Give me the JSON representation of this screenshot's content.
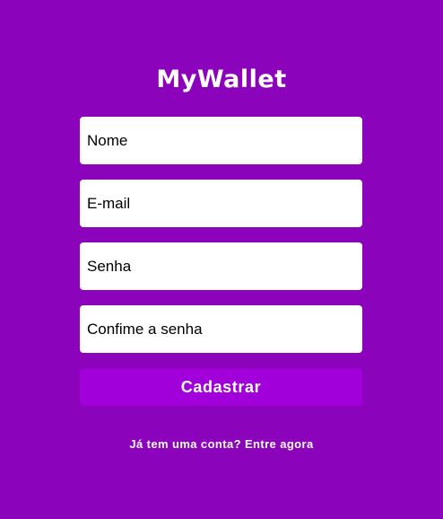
{
  "app": {
    "logo_text": "MyWallet"
  },
  "signup_form": {
    "name_placeholder": "Nome",
    "email_placeholder": "E-mail",
    "password_placeholder": "Senha",
    "confirm_password_placeholder": "Confime a senha",
    "submit_label": "Cadastrar"
  },
  "footer": {
    "login_link_text": "Já tem uma conta? Entre agora"
  },
  "colors": {
    "background": "#8C03BC",
    "button": "#A100DB",
    "input_background": "#FFFFFF",
    "text_light": "#FFFFFF"
  }
}
